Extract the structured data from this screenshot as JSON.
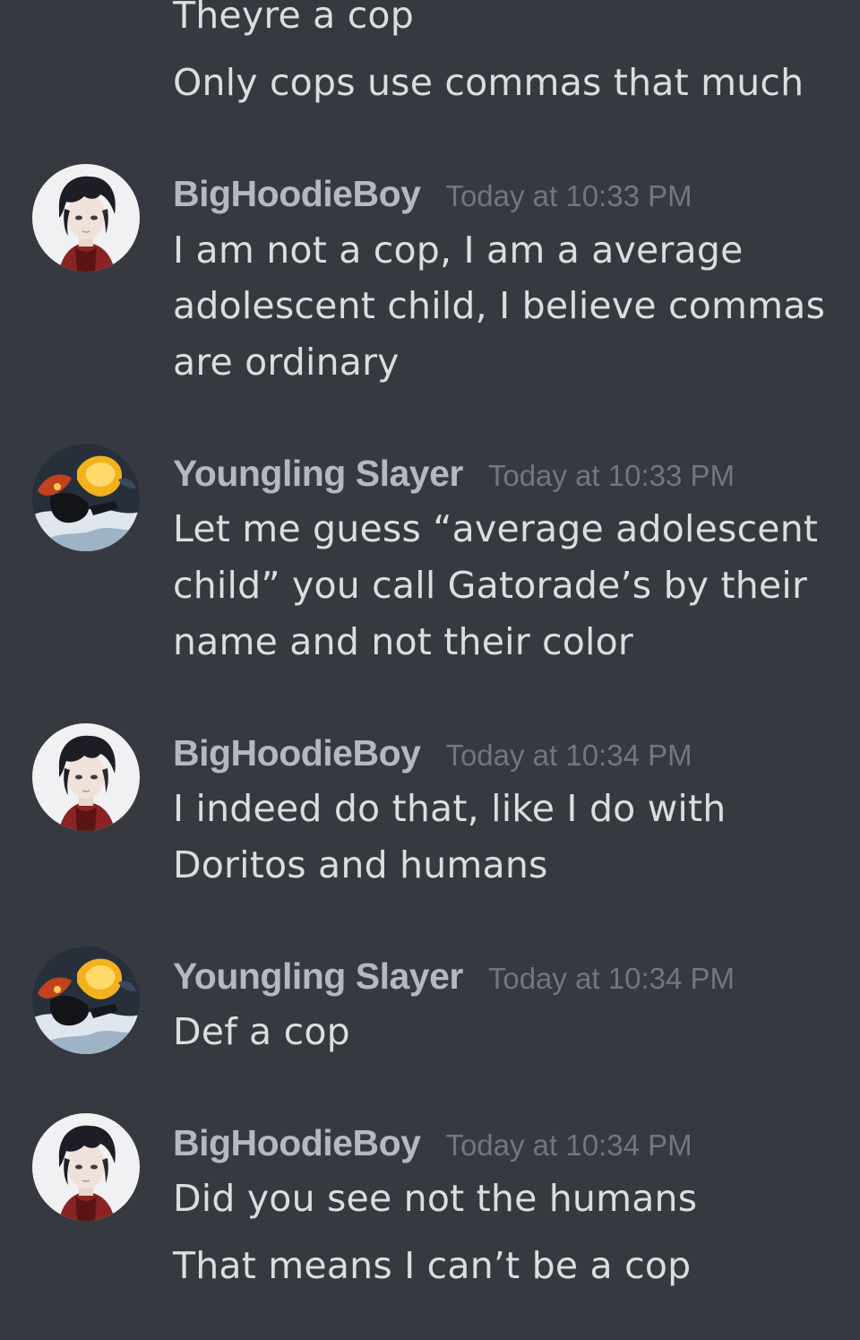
{
  "messages": {
    "m0": {
      "lines": [
        "Theyre a cop",
        "Only cops use commas that much"
      ]
    },
    "m1": {
      "username": "BigHoodieBoy",
      "timestamp": "Today at 10:33 PM",
      "avatar_icon": "hoodie-boy-avatar",
      "lines": [
        "I am not a cop, I am a average",
        "adolescent child, I believe commas",
        "are ordinary"
      ]
    },
    "m2": {
      "username": "Youngling Slayer",
      "timestamp": "Today at 10:33 PM",
      "avatar_icon": "youngling-slayer-avatar",
      "lines": [
        "Let me guess “average adolescent",
        "child” you call Gatorade’s by their",
        "name and not their color"
      ]
    },
    "m3": {
      "username": "BigHoodieBoy",
      "timestamp": "Today at 10:34 PM",
      "avatar_icon": "hoodie-boy-avatar",
      "lines": [
        "I indeed do that, like I do with",
        "Doritos and humans"
      ]
    },
    "m4": {
      "username": "Youngling Slayer",
      "timestamp": "Today at 10:34 PM",
      "avatar_icon": "youngling-slayer-avatar",
      "lines": [
        "Def a cop"
      ]
    },
    "m5": {
      "username": "BigHoodieBoy",
      "timestamp": "Today at 10:34 PM",
      "avatar_icon": "hoodie-boy-avatar",
      "lines": [
        "Did you see not the humans",
        "That means I can’t be a cop"
      ]
    }
  },
  "colors": {
    "background": "#36393f",
    "message_text": "#dcddde",
    "username": "#b3b9c0",
    "timestamp": "#72767d"
  }
}
